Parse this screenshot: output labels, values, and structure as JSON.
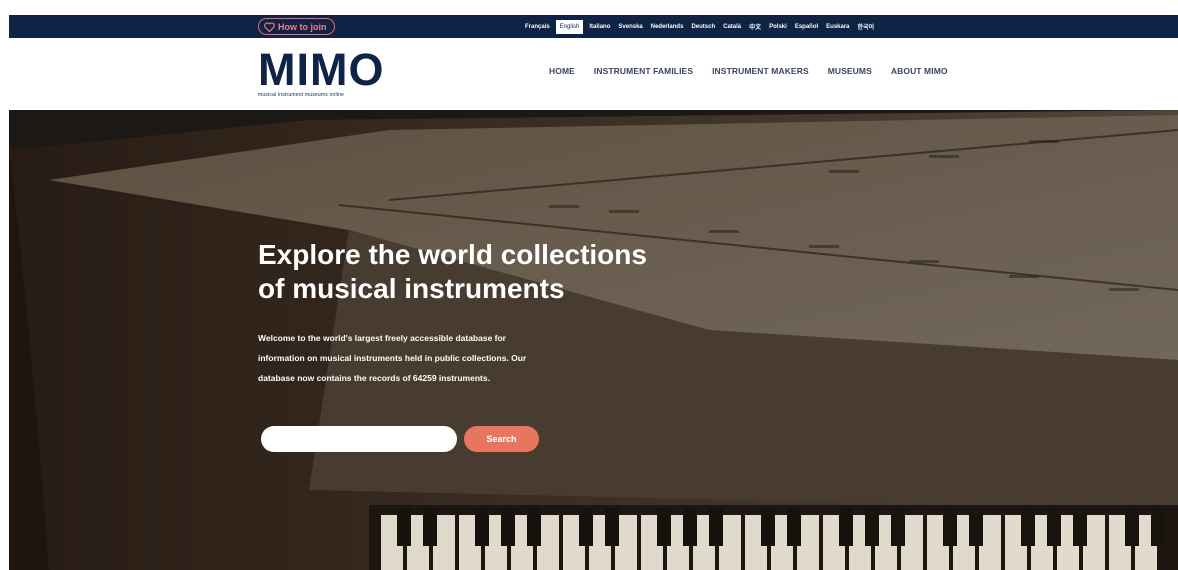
{
  "topbar": {
    "join_label": "How to join",
    "languages": [
      "Français",
      "English",
      "Italiano",
      "Svenska",
      "Nederlands",
      "Deutsch",
      "Català",
      "中文",
      "Polski",
      "Español",
      "Euskara",
      "한국어"
    ],
    "active_language": "English"
  },
  "header": {
    "logo_text": "MIMO",
    "logo_tagline": "musical instrument museums online",
    "nav": [
      "HOME",
      "INSTRUMENT FAMILIES",
      "INSTRUMENT MAKERS",
      "MUSEUMS",
      "ABOUT MIMO"
    ]
  },
  "hero": {
    "title_line1": "Explore the world collections",
    "title_line2": "of musical instruments",
    "description": "Welcome to the world's largest freely accessible database for information on musical instruments held in public collections. Our database now contains the records of 64259 instruments.",
    "search_placeholder": "",
    "search_label": "Search"
  },
  "colors": {
    "navy": "#0e2346",
    "accent": "#e8765f",
    "join_border": "#e86a6a"
  },
  "icons": {
    "join": "heart-icon"
  }
}
